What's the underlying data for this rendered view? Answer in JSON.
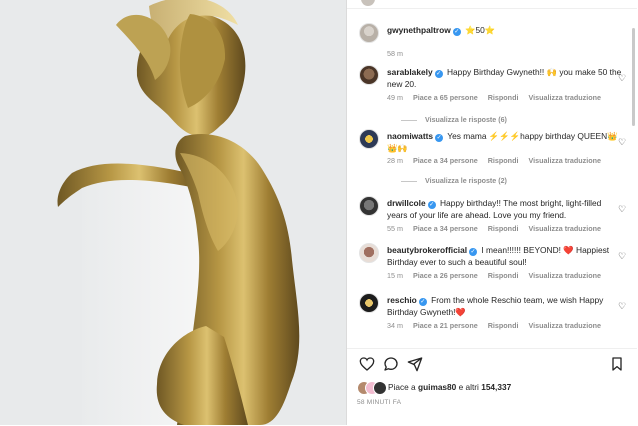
{
  "post": {
    "photo_alt": "",
    "time_ago": "58 MINUTI FA",
    "likes": {
      "prefix": "Piace a",
      "user": "guimas80",
      "middle": "e altri",
      "count": "154,337"
    }
  },
  "comments": [
    {
      "user": "gwynethpaltrow",
      "verified": true,
      "text": "⭐50⭐",
      "meta": [
        "58 m"
      ],
      "avatar": "gwyneth"
    },
    {
      "user": "sarablakely",
      "verified": true,
      "text": "Happy Birthday Gwyneth!! 🙌 you make 50 the new 20.",
      "meta": [
        "49 m",
        "Piace a 65 persone",
        "Rispondi",
        "Visualizza traduzione"
      ],
      "replies": "Visualizza le risposte (6)",
      "avatar": "sarah"
    },
    {
      "user": "naomiwatts",
      "verified": true,
      "text": "Yes mama ⚡⚡⚡happy birthday QUEEN👑👑🙌",
      "meta": [
        "28 m",
        "Piace a 34 persone",
        "Rispondi",
        "Visualizza traduzione"
      ],
      "replies": "Visualizza le risposte (2)",
      "avatar": "naomi"
    },
    {
      "user": "drwillcole",
      "verified": true,
      "text": "Happy birthday!! The most bright, light-filled years of your life are ahead. Love you my friend.",
      "meta": [
        "55 m",
        "Piace a 34 persone",
        "Rispondi",
        "Visualizza traduzione"
      ],
      "avatar": "drew"
    },
    {
      "user": "beautybrokerofficial",
      "verified": true,
      "text": "I mean!!!!!! BEYOND! ❤️ Happiest Birthday ever to such a beautiful soul!",
      "meta": [
        "15 m",
        "Piace a 26 persone",
        "Rispondi",
        "Visualizza traduzione"
      ],
      "avatar": "beauty"
    },
    {
      "user": "reschio",
      "verified": true,
      "text": "From the whole Reschio team, we wish Happy Birthday Gwyneth!❤️",
      "meta": [
        "34 m",
        "Piace a 21 persone",
        "Rispondi",
        "Visualizza traduzione"
      ],
      "avatar": "reschio"
    }
  ],
  "icons": {
    "heart": "heart-icon",
    "comment": "comment-icon",
    "share": "share-icon",
    "bookmark": "bookmark-icon"
  },
  "colors": {
    "verified": "#3897f0",
    "meta_text": "#8e8e8e",
    "border": "#dbdbdb"
  }
}
